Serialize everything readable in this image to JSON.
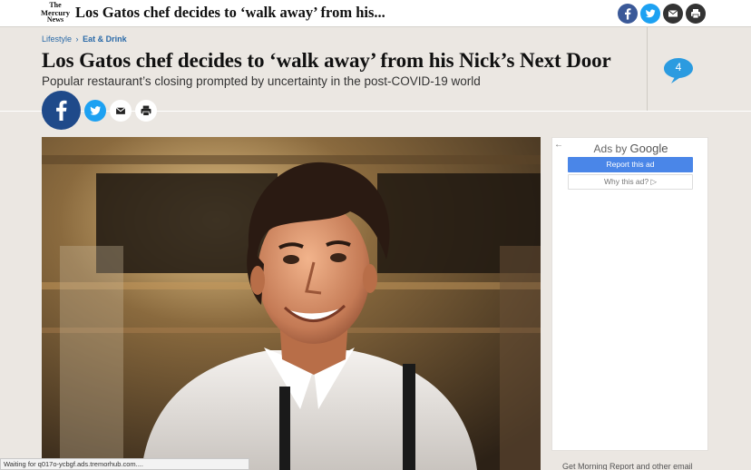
{
  "header": {
    "logo_line1": "The",
    "logo_line2": "Mercury",
    "logo_line3": "News",
    "short_title": "Los Gatos chef decides to ‘walk away’ from his..."
  },
  "top_share_icons": [
    "facebook-icon",
    "twitter-icon",
    "email-icon",
    "print-icon"
  ],
  "breadcrumb": {
    "section": "Lifestyle",
    "separator": "›",
    "subsection": "Eat & Drink"
  },
  "article": {
    "headline": "Los Gatos chef decides to ‘walk away’ from his Nick’s Next Door",
    "subhead": "Popular restaurant’s closing prompted by uncertainty in the post-COVID-19 world",
    "comment_count": "4"
  },
  "ad": {
    "back_arrow": "←",
    "label_prefix": "Ads by ",
    "label_brand": "Google",
    "report_button": "Report this ad",
    "why_button": "Why this ad? ▷"
  },
  "below_ad_text": "Get Morning Report and other email",
  "status": "Waiting for q017o-ycbgf.ads.tremorhub.com....",
  "colors": {
    "facebook": "#3b5998",
    "twitter": "#1da1f2",
    "facebook_large": "#1f4a8a",
    "comment": "#2b9be0",
    "link": "#2a6aa8",
    "background": "#ebe7e2"
  }
}
